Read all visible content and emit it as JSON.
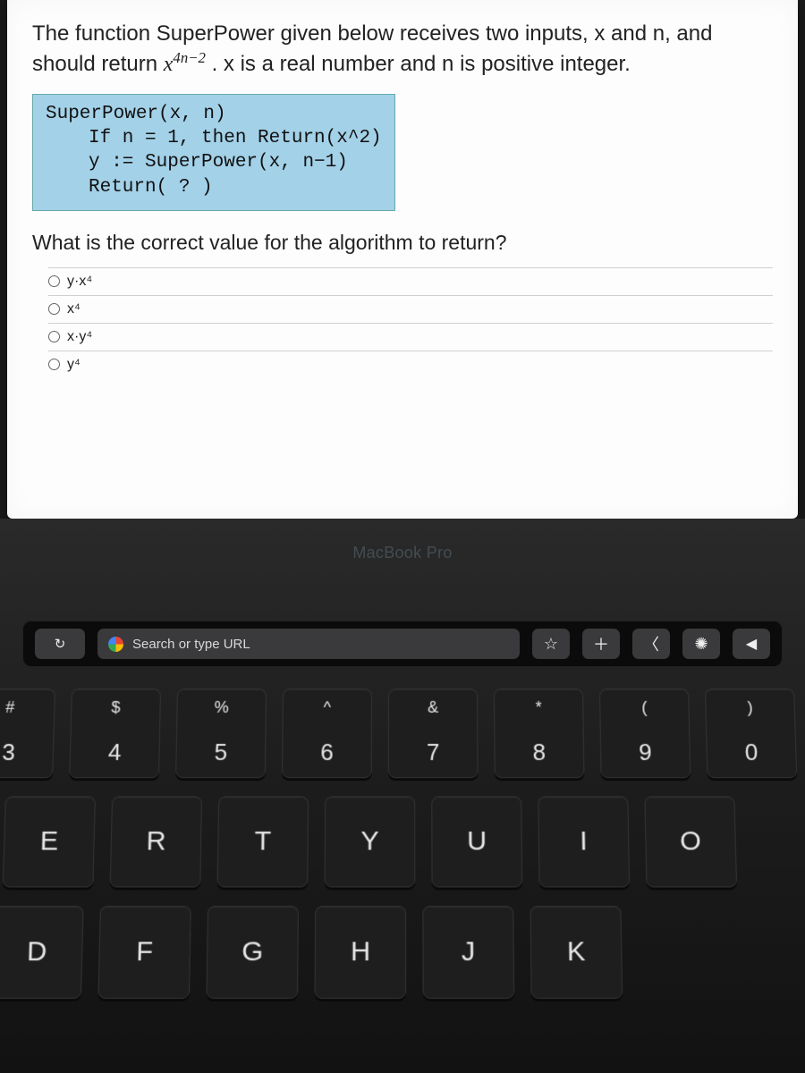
{
  "question": {
    "line1_a": "The function SuperPower given below receives two inputs, x and n, and",
    "line2_a": "should return ",
    "expr_base": "x",
    "expr_sup": "4n−2",
    "line2_b": ". x is a real number and n is positive integer."
  },
  "code": {
    "l1": "SuperPower(x, n)",
    "l2": "If n = 1, then Return(x^2)",
    "l3": "y := SuperPower(x, n−1)",
    "l4": "Return( ? )"
  },
  "q2": "What is the correct value for the algorithm to return?",
  "options": [
    "y·x⁴",
    "x⁴",
    "x·y⁴",
    "y⁴"
  ],
  "brand": "MacBook Pro",
  "touchbar": {
    "refresh_glyph": "↻",
    "search_text": "Search or type URL",
    "star_glyph": "☆",
    "plus_glyph": "＋",
    "back_glyph": "〈",
    "bright_glyph": "✺",
    "vol_glyph": "◀"
  },
  "keys": {
    "row1": [
      {
        "u": "#",
        "l": "3"
      },
      {
        "u": "$",
        "l": "4"
      },
      {
        "u": "%",
        "l": "5"
      },
      {
        "u": "^",
        "l": "6"
      },
      {
        "u": "&",
        "l": "7"
      },
      {
        "u": "*",
        "l": "8"
      },
      {
        "u": "(",
        "l": "9"
      },
      {
        "u": ")",
        "l": "0"
      }
    ],
    "row2": [
      "E",
      "R",
      "T",
      "Y",
      "U",
      "I",
      "O"
    ],
    "row3": [
      "D",
      "F",
      "G",
      "H",
      "J",
      "K"
    ]
  }
}
